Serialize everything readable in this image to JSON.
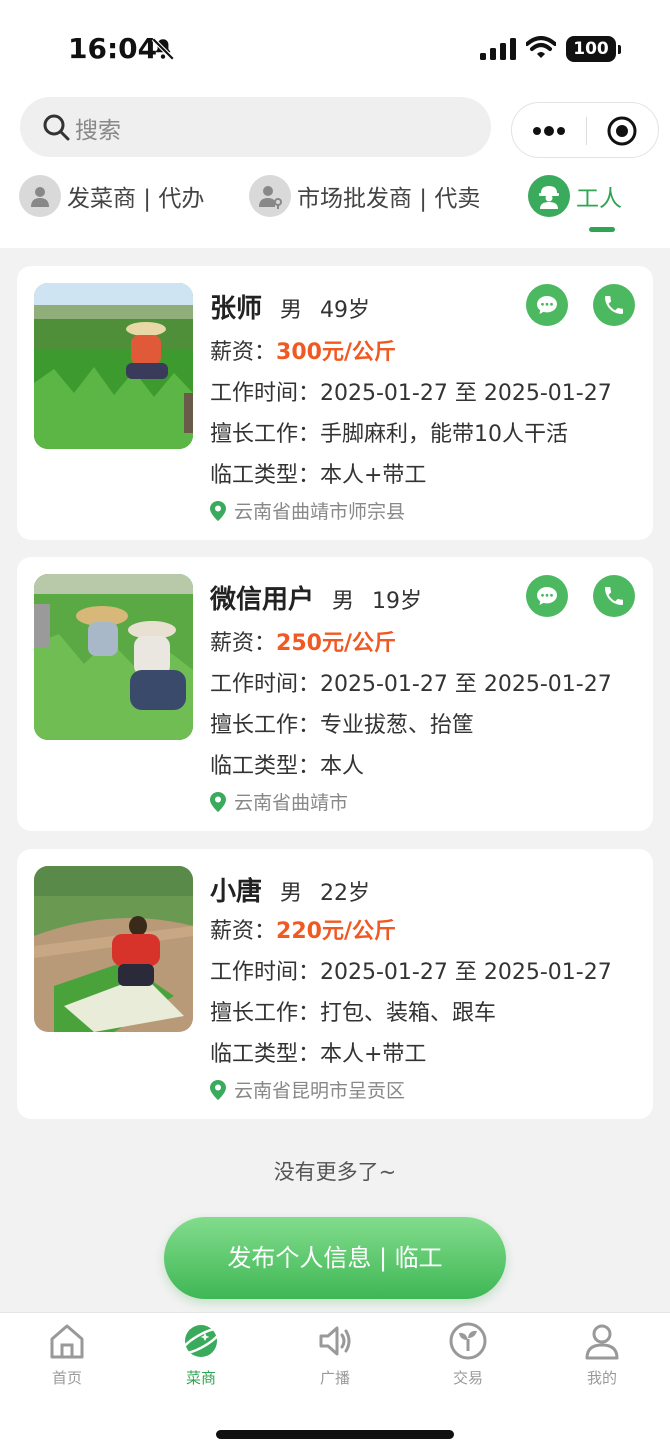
{
  "status_bar": {
    "time": "16:04",
    "battery": "100"
  },
  "search": {
    "placeholder": "搜索"
  },
  "categories": [
    {
      "label": "发菜商 | 代办"
    },
    {
      "label": "市场批发商 | 代卖"
    },
    {
      "label": "工人"
    }
  ],
  "workers": [
    {
      "name": "张师",
      "gender": "男",
      "age": "49岁",
      "wage_label": "薪资：",
      "wage": "300元/公斤",
      "work_time": "工作时间：2025-01-27 至 2025-01-27",
      "skill": "擅长工作：手脚麻利，能带10人干活",
      "type": "临工类型：本人+带工",
      "location": "云南省曲靖市师宗县"
    },
    {
      "name": "微信用户",
      "gender": "男",
      "age": "19岁",
      "wage_label": "薪资：",
      "wage": "250元/公斤",
      "work_time": "工作时间：2025-01-27 至 2025-01-27",
      "skill": "擅长工作：专业拔葱、抬筐",
      "type": "临工类型：本人",
      "location": "云南省曲靖市"
    },
    {
      "name": "小唐",
      "gender": "男",
      "age": "22岁",
      "wage_label": "薪资：",
      "wage": "220元/公斤",
      "work_time": "工作时间：2025-01-27 至 2025-01-27",
      "skill": "擅长工作：打包、装箱、跟车",
      "type": "临工类型：本人+带工",
      "location": "云南省昆明市呈贡区"
    }
  ],
  "no_more": "没有更多了~",
  "publish_button": "发布个人信息 | 临工",
  "tabbar": [
    {
      "label": "首页",
      "icon": "home-icon"
    },
    {
      "label": "菜商",
      "icon": "planet-icon"
    },
    {
      "label": "广播",
      "icon": "speaker-icon"
    },
    {
      "label": "交易",
      "icon": "sprout-icon"
    },
    {
      "label": "我的",
      "icon": "user-icon"
    }
  ],
  "colors": {
    "accent": "#2fa552",
    "price": "#f05a22"
  }
}
